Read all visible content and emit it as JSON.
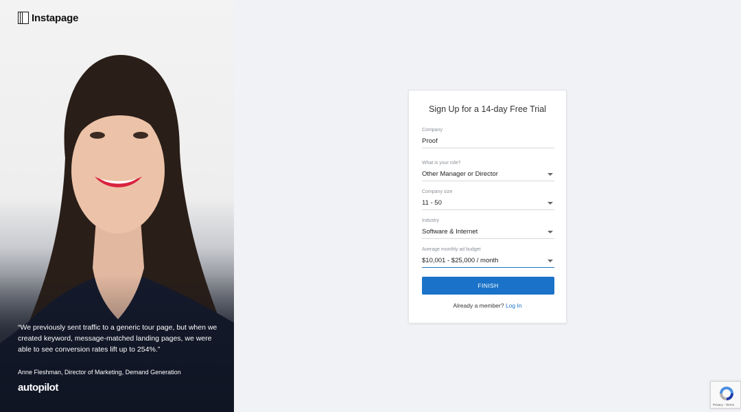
{
  "brand": {
    "logo_text": "Instapage"
  },
  "testimonial": {
    "quote": "“We previously sent traffic to a generic tour page, but when we created keyword, message-matched landing pages, we were able to see conversion rates lift up to 254%.”",
    "author": "Anne Fleshman, Director of Marketing, Demand Generation",
    "company_logo": "autopilot"
  },
  "form": {
    "title": "Sign Up for a 14-day Free Trial",
    "fields": [
      {
        "label": "Company",
        "value": "Proof",
        "type": "text"
      },
      {
        "label": "What is your role?",
        "value": "Other Manager or Director",
        "type": "select"
      },
      {
        "label": "Company size",
        "value": "11 - 50",
        "type": "select"
      },
      {
        "label": "Industry",
        "value": "Software & Internet",
        "type": "select"
      },
      {
        "label": "Average monthly ad budget",
        "value": "$10,001 - $25,000 / month",
        "type": "select"
      }
    ],
    "submit_label": "FINISH",
    "member_prompt": "Already a member?",
    "login_label": "Log In"
  },
  "recaptcha": {
    "terms_text": "Privacy - Terms"
  },
  "colors": {
    "accent": "#1a73c8",
    "page_bg": "#f0f2f5"
  }
}
